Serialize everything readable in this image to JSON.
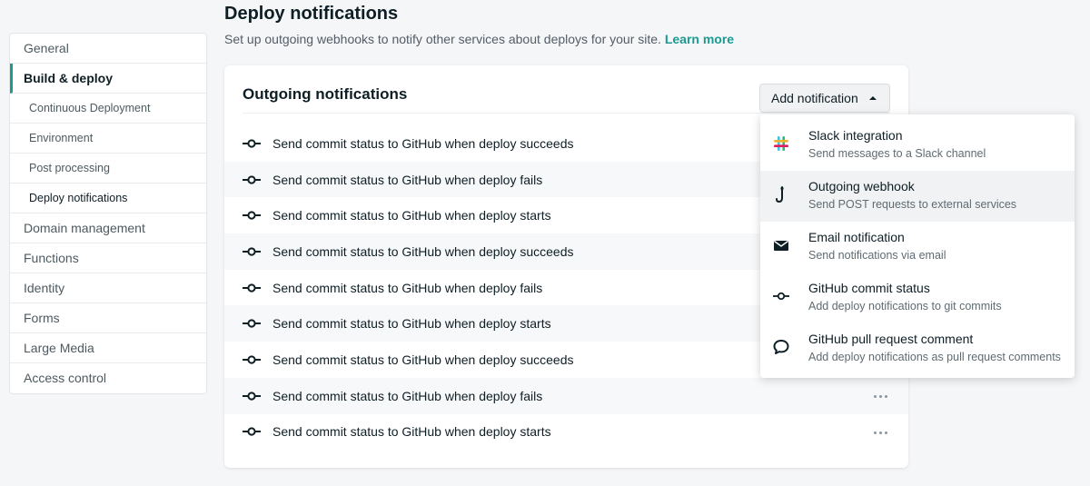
{
  "sidebar": {
    "items": [
      {
        "label": "General"
      },
      {
        "label": "Build & deploy"
      },
      {
        "label": "Continuous Deployment"
      },
      {
        "label": "Environment"
      },
      {
        "label": "Post processing"
      },
      {
        "label": "Deploy notifications"
      },
      {
        "label": "Domain management"
      },
      {
        "label": "Functions"
      },
      {
        "label": "Identity"
      },
      {
        "label": "Forms"
      },
      {
        "label": "Large Media"
      },
      {
        "label": "Access control"
      }
    ]
  },
  "header": {
    "title": "Deploy notifications",
    "description": "Set up outgoing webhooks to notify other services about deploys for your site.",
    "learn_more": "Learn more"
  },
  "card": {
    "title": "Outgoing notifications",
    "add_button": "Add notification",
    "rows": [
      {
        "text": "Send commit status to GitHub when deploy succeeds"
      },
      {
        "text": "Send commit status to GitHub when deploy fails"
      },
      {
        "text": "Send commit status to GitHub when deploy starts"
      },
      {
        "text": "Send commit status to GitHub when deploy succeeds"
      },
      {
        "text": "Send commit status to GitHub when deploy fails"
      },
      {
        "text": "Send commit status to GitHub when deploy starts"
      },
      {
        "text": "Send commit status to GitHub when deploy succeeds"
      },
      {
        "text": "Send commit status to GitHub when deploy fails"
      },
      {
        "text": "Send commit status to GitHub when deploy starts"
      }
    ]
  },
  "dropdown": {
    "items": [
      {
        "title": "Slack integration",
        "desc": "Send messages to a Slack channel",
        "icon": "slack-icon"
      },
      {
        "title": "Outgoing webhook",
        "desc": "Send POST requests to external services",
        "icon": "webhook-icon"
      },
      {
        "title": "Email notification",
        "desc": "Send notifications via email",
        "icon": "envelope-icon"
      },
      {
        "title": "GitHub commit status",
        "desc": "Add deploy notifications to git commits",
        "icon": "git-commit-icon"
      },
      {
        "title": "GitHub pull request comment",
        "desc": "Add deploy notifications as pull request comments",
        "icon": "speech-bubble-icon"
      }
    ]
  },
  "colors": {
    "accent": "#1b9a92",
    "text": "#0e1e25",
    "background": "#f5f6f8"
  }
}
